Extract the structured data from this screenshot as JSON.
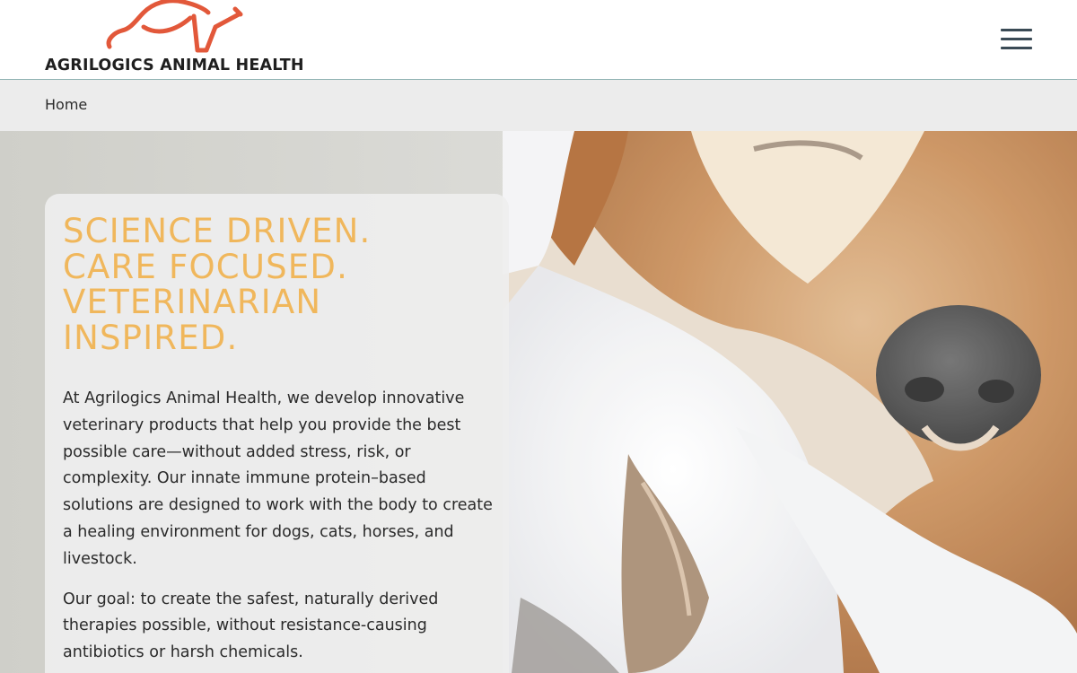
{
  "brand": {
    "name": "AGRILOGICS ANIMAL HEALTH",
    "logo_icon": "bull-horns-logo-icon",
    "accent_color": "#e2583a"
  },
  "header": {
    "menu_icon": "hamburger-menu-icon"
  },
  "breadcrumb": {
    "home_label": "Home"
  },
  "hero": {
    "heading_lines": [
      "SCIENCE DRIVEN.",
      "CARE FOCUSED.",
      "VETERINARIAN",
      "INSPIRED."
    ],
    "heading_color": "#f0b75c",
    "paragraphs": [
      "At Agrilogics Animal Health, we develop innovative veterinary products that help you provide the best possible care—without added stress, risk, or complexity. Our innate immune protein–based solutions are designed to work with the body to create a healing environment for dogs, cats, horses, and livestock.",
      "Our goal: to create the safest, naturally derived therapies possible, without resistance-causing antibiotics or harsh chemicals."
    ],
    "background_image": "dog-and-cat-with-veterinarian-gloves-photo"
  }
}
